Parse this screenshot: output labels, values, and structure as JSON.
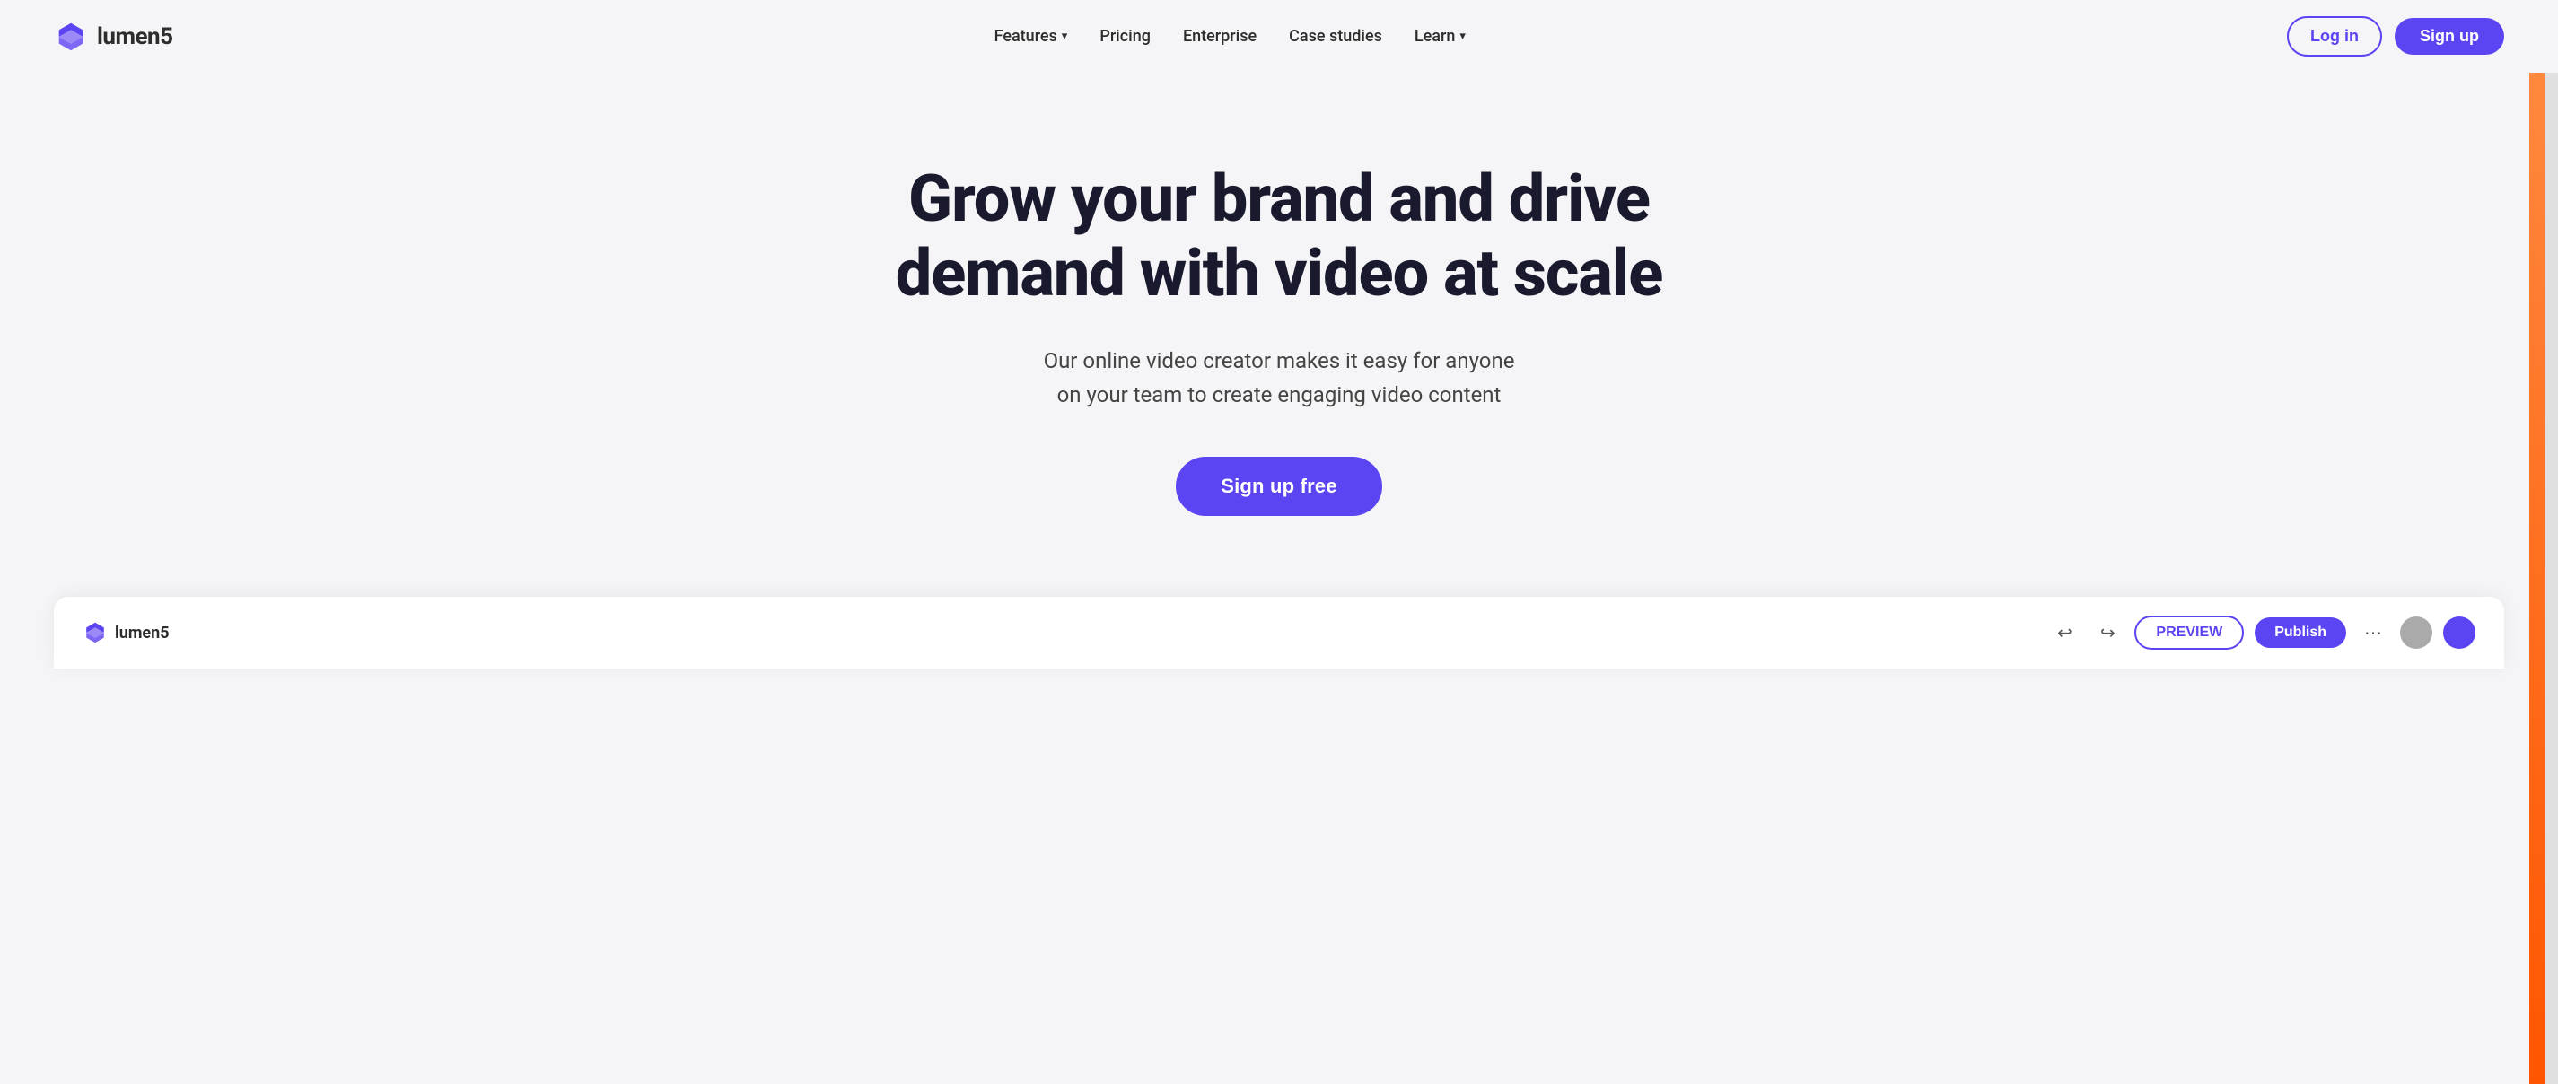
{
  "brand": {
    "name": "lumen5",
    "logo_alt": "Lumen5 logo"
  },
  "navbar": {
    "features_label": "Features",
    "pricing_label": "Pricing",
    "enterprise_label": "Enterprise",
    "case_studies_label": "Case studies",
    "learn_label": "Learn",
    "login_label": "Log in",
    "signup_label": "Sign up"
  },
  "hero": {
    "title_line1": "Grow your brand and drive",
    "title_line2": "demand with video at scale",
    "subtitle": "Our online video creator makes it easy for anyone on your team to create engaging video content",
    "cta_label": "Sign up free"
  },
  "preview": {
    "logo_text": "lumen5",
    "preview_btn_label": "PREVIEW",
    "publish_btn_label": "Publish",
    "more_icon": "⋯"
  },
  "colors": {
    "brand_purple": "#5b44f2",
    "bg_light": "#f5f5f7",
    "text_dark": "#1a1a2e",
    "text_mid": "#444444"
  }
}
